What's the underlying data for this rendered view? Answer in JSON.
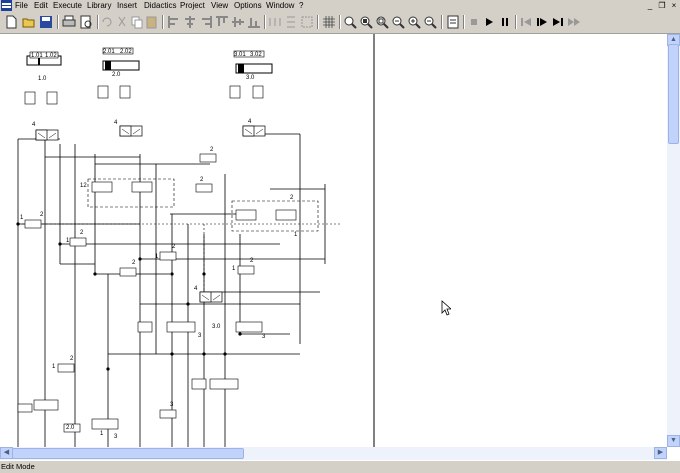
{
  "menu": [
    "File",
    "Edit",
    "Execute",
    "Library",
    "Insert",
    "Didactics",
    "Project",
    "View",
    "Options",
    "Window",
    "?"
  ],
  "window_controls": {
    "minimize": "_",
    "restore": "❐",
    "close": "×"
  },
  "toolbar": [
    "new-icon",
    "open-icon",
    "save-icon",
    "print-icon",
    "print-preview-icon",
    "undo-icon",
    "cut-icon",
    "copy-icon",
    "paste-icon",
    "align-left-icon",
    "align-center-icon",
    "align-right-icon",
    "align-top-icon",
    "align-middle-icon",
    "align-bottom-icon",
    "grid-icon",
    "zoom-icon",
    "zoom-in-icon",
    "zoom-window-icon",
    "zoom-fit-icon",
    "zoom-plus-icon",
    "zoom-minus-icon",
    "properties-icon",
    "stop-icon",
    "play-icon",
    "pause-icon",
    "reset-icon",
    "single-step-icon",
    "step-to-end-icon",
    "fast-forward-icon"
  ],
  "diagram": {
    "cylinders": [
      "1.0",
      "2.0",
      "3.0"
    ],
    "sensor_labels": [
      "1.01",
      "1.02",
      "2.01",
      "2.02",
      "3.01",
      "3.02"
    ],
    "valve_labels": [
      "1.0",
      "2.0",
      "3.0"
    ],
    "port_labels": [
      "1",
      "2",
      "3",
      "4",
      "12"
    ]
  },
  "status": {
    "mode": "Edit Mode"
  }
}
